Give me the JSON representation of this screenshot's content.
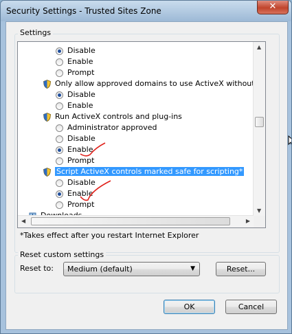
{
  "window": {
    "title": "Security Settings - Trusted Sites Zone",
    "close_label": "✕"
  },
  "settings": {
    "group_label": "Settings",
    "items": [
      {
        "kind": "radio",
        "label": "Disable",
        "checked": true
      },
      {
        "kind": "radio",
        "label": "Enable",
        "checked": false
      },
      {
        "kind": "radio",
        "label": "Prompt",
        "checked": false
      },
      {
        "kind": "header",
        "label": "Only allow approved domains to use ActiveX without prompt"
      },
      {
        "kind": "radio",
        "label": "Disable",
        "checked": true
      },
      {
        "kind": "radio",
        "label": "Enable",
        "checked": false
      },
      {
        "kind": "header",
        "label": "Run ActiveX controls and plug-ins"
      },
      {
        "kind": "radio",
        "label": "Administrator approved",
        "checked": false
      },
      {
        "kind": "radio",
        "label": "Disable",
        "checked": false
      },
      {
        "kind": "radio",
        "label": "Enable",
        "checked": true
      },
      {
        "kind": "radio",
        "label": "Prompt",
        "checked": false
      },
      {
        "kind": "header",
        "label": "Script ActiveX controls marked safe for scripting*",
        "selected": true
      },
      {
        "kind": "radio",
        "label": "Disable",
        "checked": false
      },
      {
        "kind": "radio",
        "label": "Enable",
        "checked": true
      },
      {
        "kind": "radio",
        "label": "Prompt",
        "checked": false
      },
      {
        "kind": "section",
        "label": "Downloads"
      }
    ],
    "note": "*Takes effect after you restart Internet Explorer",
    "vscroll_position": 0.45
  },
  "reset": {
    "group_label": "Reset custom settings",
    "reset_to_label": "Reset to:",
    "selected_level": "Medium (default)",
    "reset_button": "Reset..."
  },
  "footer": {
    "ok": "OK",
    "cancel": "Cancel"
  },
  "colors": {
    "selection": "#3399ff",
    "annotation": "#e0201a"
  }
}
